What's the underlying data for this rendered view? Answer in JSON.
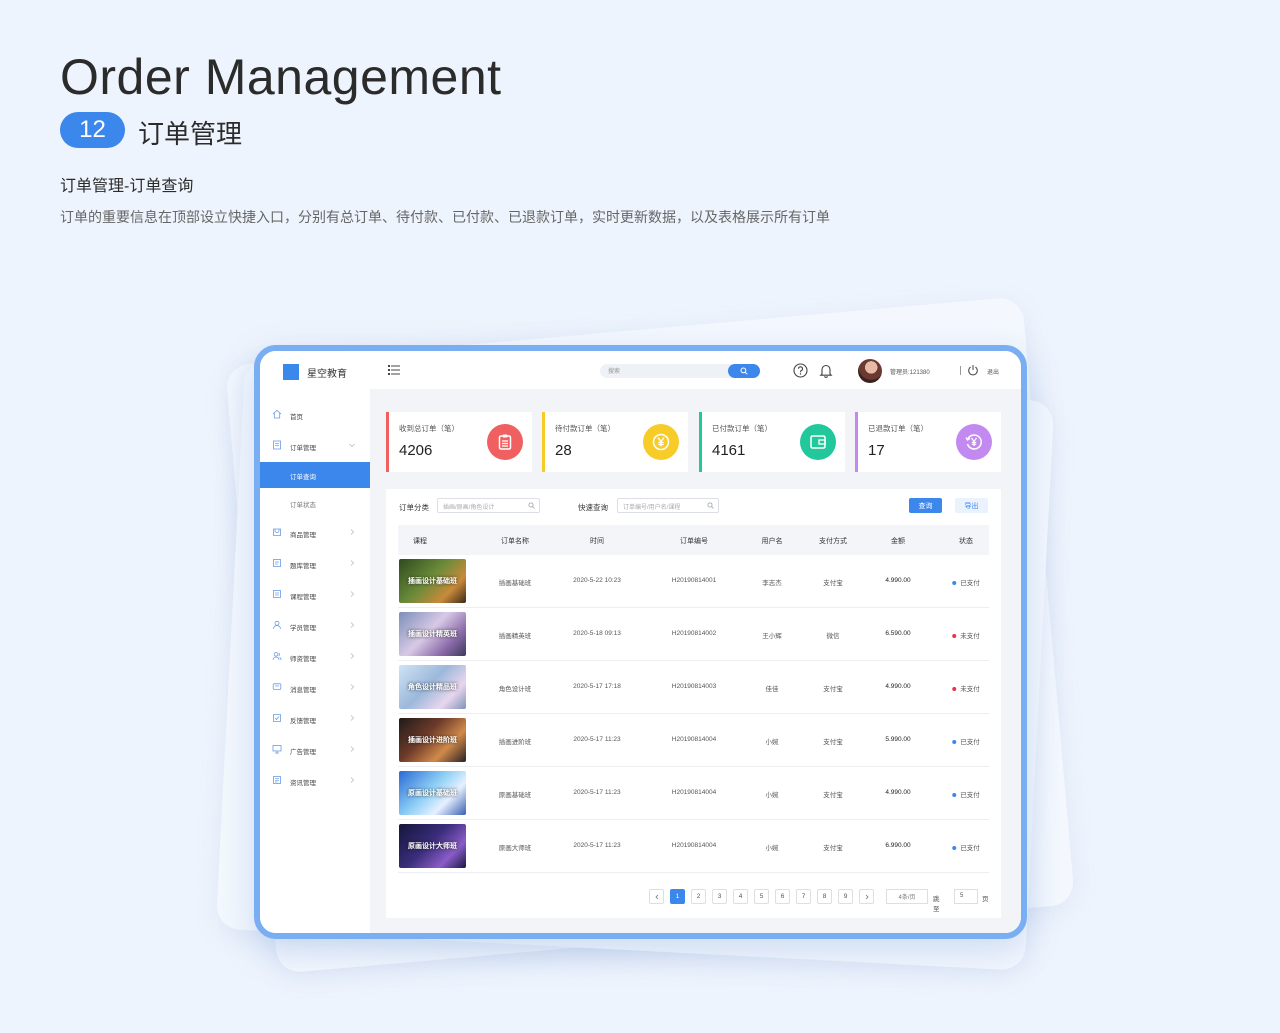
{
  "hero": {
    "title": "Order Management",
    "badge": "12",
    "subtitle": "订单管理",
    "section": "订单管理-订单查询",
    "description": "订单的重要信息在顶部设立快捷入口，分别有总订单、待付款、已付款、已退款订单，实时更新数据，以及表格展示所有订单"
  },
  "app": {
    "brand": "星空教育",
    "search_placeholder": "搜索",
    "admin_label": "管理员:121380",
    "logout_label": "退出"
  },
  "sidebar": {
    "items": [
      {
        "label": "首页",
        "icon": "home-icon"
      },
      {
        "label": "订单管理",
        "icon": "order-icon",
        "expanded": true
      },
      {
        "label": "商品管理",
        "icon": "goods-icon"
      },
      {
        "label": "题库管理",
        "icon": "question-bank-icon"
      },
      {
        "label": "课程管理",
        "icon": "course-icon"
      },
      {
        "label": "学员管理",
        "icon": "student-icon"
      },
      {
        "label": "师资管理",
        "icon": "teacher-icon"
      },
      {
        "label": "消息管理",
        "icon": "message-icon"
      },
      {
        "label": "反馈管理",
        "icon": "feedback-icon"
      },
      {
        "label": "广告管理",
        "icon": "ad-icon"
      },
      {
        "label": "资讯管理",
        "icon": "news-icon"
      }
    ],
    "sub_items": [
      {
        "label": "订单查询",
        "active": true
      },
      {
        "label": "订单状态",
        "active": false
      }
    ]
  },
  "stats": [
    {
      "label": "收到总订单（笔）",
      "value": "4206",
      "color": "#f06060",
      "icon": "clipboard-icon"
    },
    {
      "label": "待付款订单（笔）",
      "value": "28",
      "color": "#f7cc29",
      "icon": "yen-pending-icon"
    },
    {
      "label": "已付款订单（笔）",
      "value": "4161",
      "color": "#22c79b",
      "icon": "wallet-icon"
    },
    {
      "label": "已退款订单（笔）",
      "value": "17",
      "color": "#c28af0",
      "icon": "yen-refund-icon"
    }
  ],
  "filters": {
    "category_label": "订单分类",
    "category_placeholder": "插画/原画/角色设计",
    "quick_label": "快速查询",
    "quick_placeholder": "订单编号/用户名/课程",
    "query_button": "查询",
    "export_button": "导出"
  },
  "table": {
    "columns": [
      "课程",
      "订单名称",
      "时间",
      "订单编号",
      "用户名",
      "支付方式",
      "金额",
      "状态"
    ],
    "rows": [
      {
        "thumb": "插画设计基础班",
        "name": "插画基础班",
        "time": "2020-5-22 10:23",
        "order_no": "H20190814001",
        "user": "李志杰",
        "pay": "支付宝",
        "amount": "4.990.00",
        "status": "已支付",
        "paid": true
      },
      {
        "thumb": "插画设计精英班",
        "name": "插画精英班",
        "time": "2020-5-18 09:13",
        "order_no": "H20190814002",
        "user": "王小辉",
        "pay": "微信",
        "amount": "6.590.00",
        "status": "未支付",
        "paid": false
      },
      {
        "thumb": "角色设计精品班",
        "name": "角色设计班",
        "time": "2020-5-17 17:18",
        "order_no": "H20190814003",
        "user": "佳佳",
        "pay": "支付宝",
        "amount": "4.990.00",
        "status": "未支付",
        "paid": false
      },
      {
        "thumb": "插画设计进阶班",
        "name": "插画进阶班",
        "time": "2020-5-17 11:23",
        "order_no": "H20190814004",
        "user": "小婉",
        "pay": "支付宝",
        "amount": "5.990.00",
        "status": "已支付",
        "paid": true
      },
      {
        "thumb": "原画设计基础班",
        "name": "原画基础班",
        "time": "2020-5-17 11:23",
        "order_no": "H20190814004",
        "user": "小婉",
        "pay": "支付宝",
        "amount": "4.990.00",
        "status": "已支付",
        "paid": true
      },
      {
        "thumb": "原画设计大师班",
        "name": "原画大师班",
        "time": "2020-5-17 11:23",
        "order_no": "H20190814004",
        "user": "小婉",
        "pay": "支付宝",
        "amount": "6.990.00",
        "status": "已支付",
        "paid": true
      }
    ]
  },
  "pagination": {
    "pages": [
      "1",
      "2",
      "3",
      "4",
      "5",
      "6",
      "7",
      "8",
      "9"
    ],
    "current": "1",
    "page_size": "4条/页",
    "jump_label": "跳至",
    "jump_value": "5",
    "page_suffix": "页"
  },
  "colors": {
    "accent": "#3c87ec",
    "paid_dot": "#3c87ec",
    "unpaid_dot": "#e8334a"
  }
}
